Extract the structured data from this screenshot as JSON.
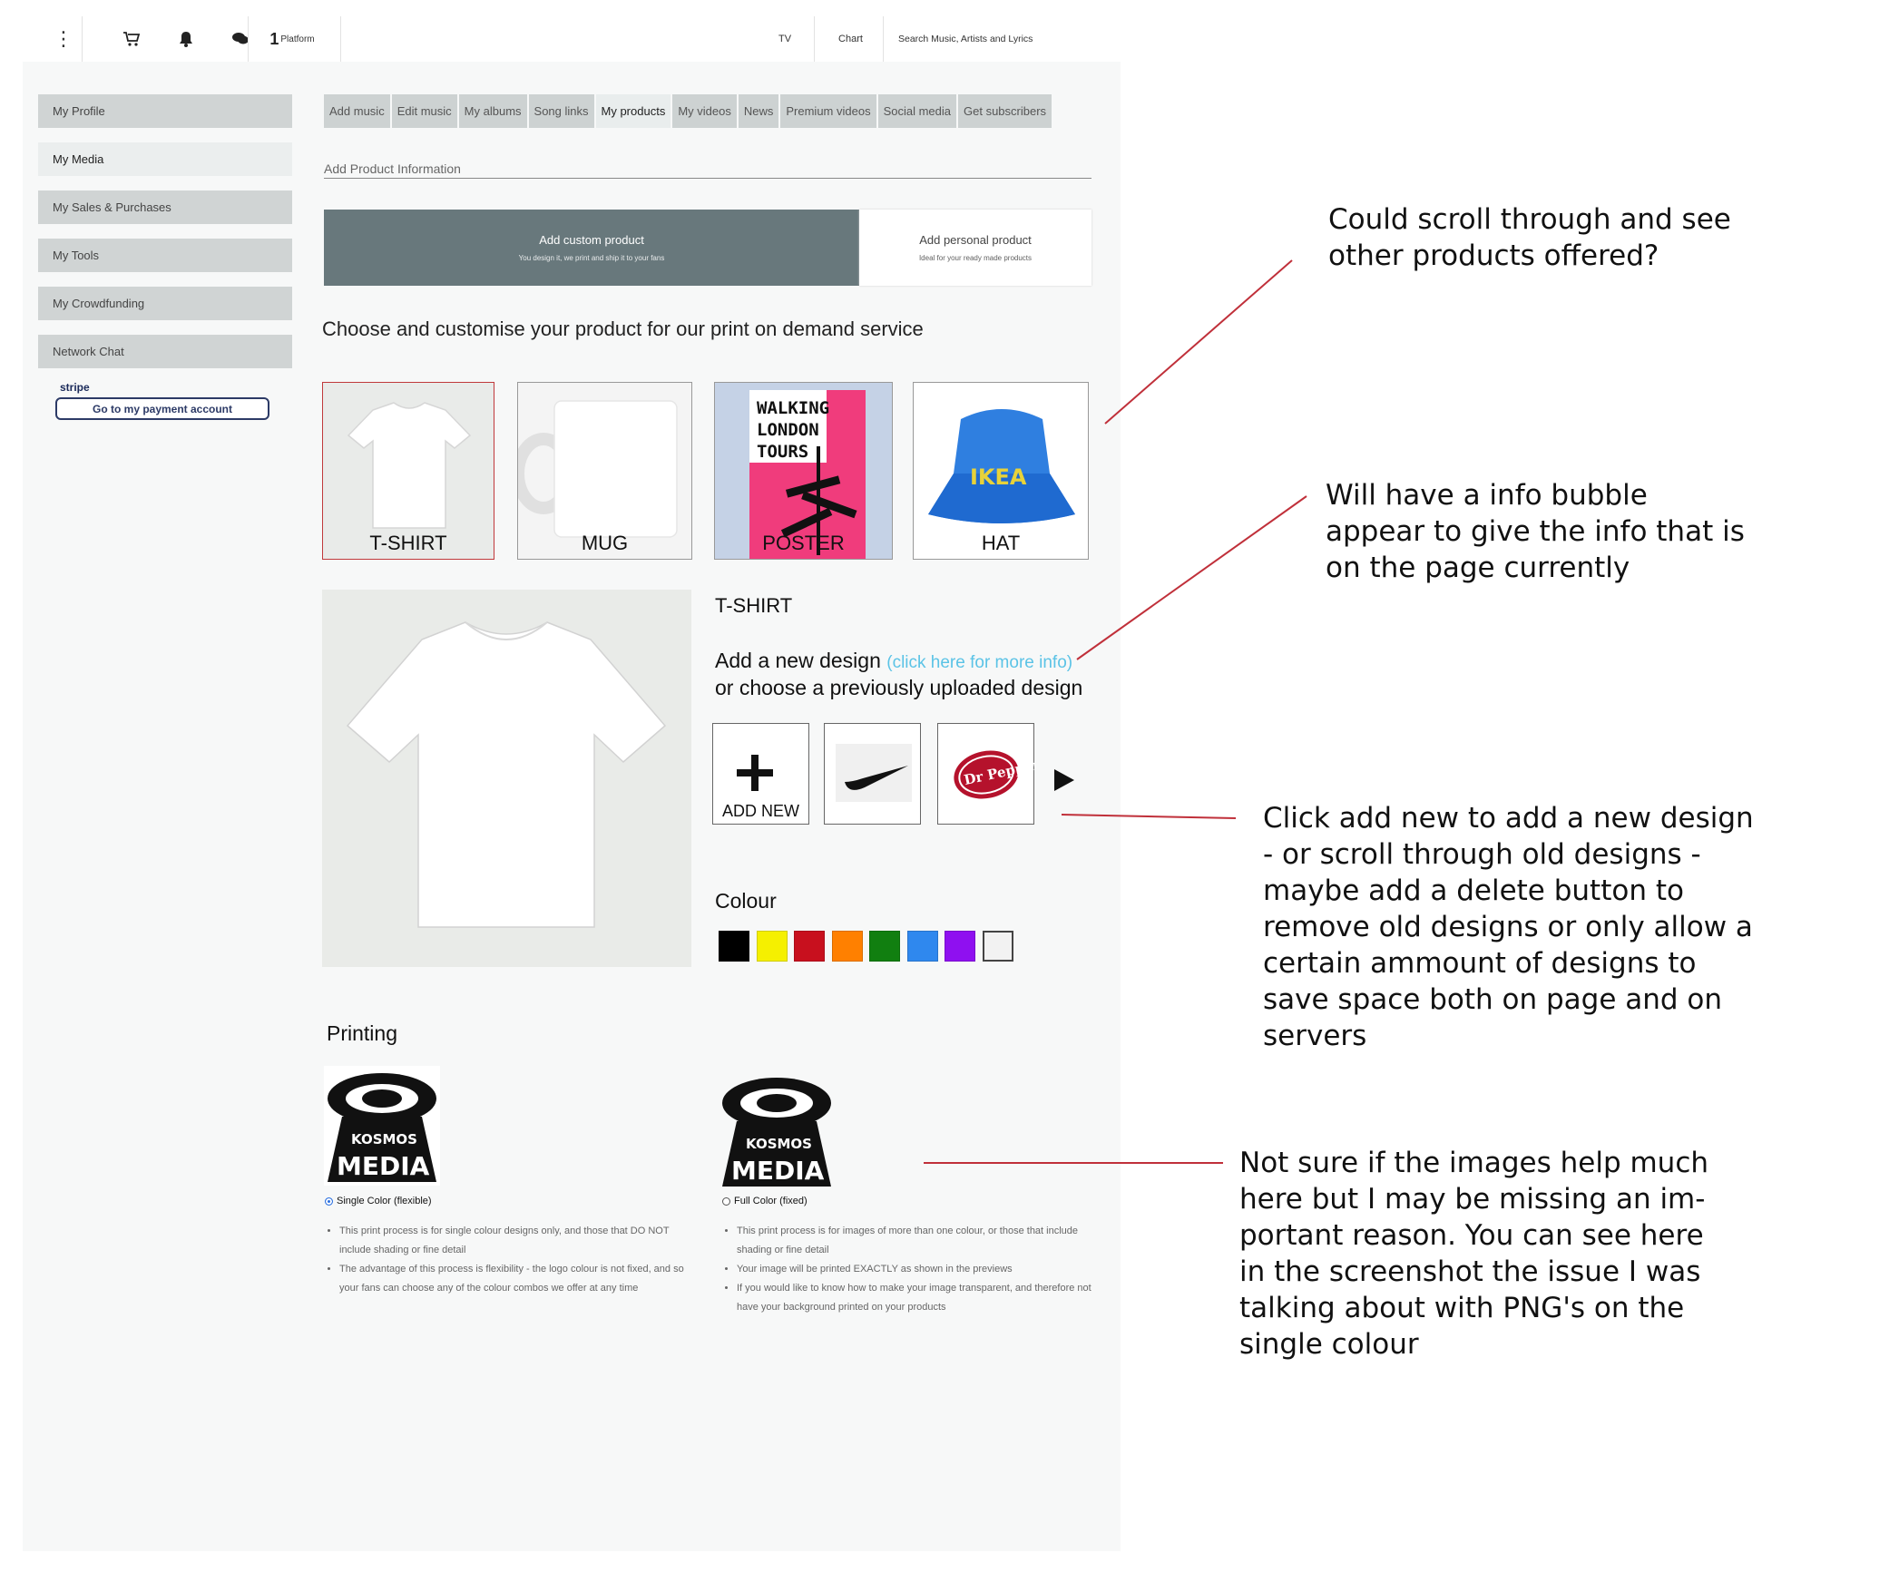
{
  "topbar": {
    "menu_glyph": "⋮",
    "icons": [
      "menu-icon",
      "cart-icon",
      "bell-icon",
      "chat-icon"
    ],
    "brand_number": "1",
    "brand_text": "Platform",
    "links": [
      "TV",
      "Chart"
    ],
    "search_placeholder": "Search Music, Artists and Lyrics"
  },
  "sidebar": {
    "items": [
      {
        "label": "My Profile"
      },
      {
        "label": "My Media",
        "active": true
      },
      {
        "label": "My Sales & Purchases"
      },
      {
        "label": "My Tools"
      },
      {
        "label": "My Crowdfunding"
      },
      {
        "label": "Network Chat"
      }
    ],
    "stripe_logo": "stripe",
    "payment_button": "Go to my payment account"
  },
  "tabs": [
    {
      "label": "Add music"
    },
    {
      "label": "Edit music"
    },
    {
      "label": "My albums"
    },
    {
      "label": "Song links"
    },
    {
      "label": "My products",
      "active": true
    },
    {
      "label": "My videos"
    },
    {
      "label": "News"
    },
    {
      "label": "Premium videos"
    },
    {
      "label": "Social media"
    },
    {
      "label": "Get subscribers"
    }
  ],
  "section_title": "Add Product Information",
  "product_type": {
    "custom_title": "Add custom product",
    "custom_sub": "You design it, we print and ship it to your fans",
    "personal_title": "Add personal product",
    "personal_sub": "Ideal for your ready made products"
  },
  "choose_text": "Choose and customise your product for our print on demand service",
  "products": [
    {
      "label": "T-SHIRT",
      "selected": true
    },
    {
      "label": "MUG"
    },
    {
      "label": "POSTER",
      "poster_text": [
        "WALKING",
        "LONDON",
        "TOURS"
      ]
    },
    {
      "label": "HAT",
      "hat_text": "IKEA"
    }
  ],
  "preview": {
    "product_name": "T-SHIRT",
    "add_design": "Add a new design",
    "more_info": "(click here for more info)",
    "previous": "or choose a previously uploaded design",
    "add_new": "ADD NEW",
    "designs": [
      "nike-swoosh-logo",
      "dr-pepper-logo"
    ],
    "drpepper_text": "Dr Pepper"
  },
  "colour": {
    "label": "Colour",
    "swatches": [
      "#000000",
      "#f5f000",
      "#c8101e",
      "#ff8000",
      "#117f10",
      "#2f88ee",
      "#8f10f0",
      "#f2f2f2"
    ]
  },
  "printing": {
    "label": "Printing",
    "logo_text": [
      "KOSMOS",
      "MEDIA"
    ],
    "options": [
      {
        "label": "Single Color (flexible)",
        "selected": true,
        "bullets": [
          "This print process is for single colour designs only, and those that DO NOT include shading or fine detail",
          "The advantage of this process is flexibility - the logo colour is not fixed, and so your fans can choose any of the colour combos we offer at any time"
        ]
      },
      {
        "label": "Full Color (fixed)",
        "selected": false,
        "bullets": [
          "This print process is for images of more than one colour, or those that include shading or fine detail",
          "Your image will be printed EXACTLY as shown in the previews",
          "If you would like to know how to make your image transparent, and therefore not have your background printed on your products"
        ]
      }
    ]
  },
  "annotations": [
    {
      "text": "Could scroll through and see\nother products offered?"
    },
    {
      "text": "Will have a info bubble\nappear to give the info that is\non the page currently"
    },
    {
      "text": "Click add new to add a new design\n- or scroll through old designs -\nmaybe add a delete button to\nremove old designs or only allow a\ncertain ammount of designs to\nsave space both on page and on\nservers"
    },
    {
      "text": "Not sure if the images help much\nhere but I may be missing an im-\nportant reason. You can see here\nin the screenshot the issue I was\ntalking about with PNG's on the\nsingle colour"
    }
  ],
  "colors": {
    "annotation_line": "#c0303a",
    "sidebar_bg": "#d0d4d4",
    "custom_btn_bg": "#68787c",
    "info_link": "#5bc3e6"
  }
}
